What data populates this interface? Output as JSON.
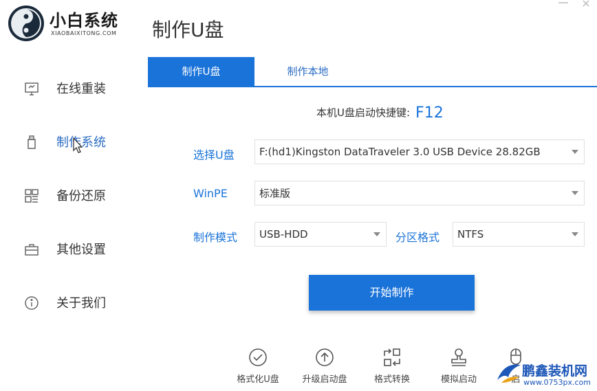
{
  "brand": {
    "name": "小白系统",
    "subtitle": "XIAOBAIXITONG.COM"
  },
  "sidebar": {
    "items": [
      {
        "label": "在线重装",
        "icon": "monitor-icon"
      },
      {
        "label": "制作系统",
        "icon": "usb-drive-icon"
      },
      {
        "label": "备份还原",
        "icon": "grid-icon"
      },
      {
        "label": "其他设置",
        "icon": "toolbox-icon"
      },
      {
        "label": "关于我们",
        "icon": "info-icon"
      }
    ]
  },
  "main": {
    "title": "制作U盘",
    "tabs": [
      {
        "label": "制作U盘",
        "active": true
      },
      {
        "label": "制作本地",
        "active": false
      }
    ],
    "hotkey_label": "本机U盘启动快捷键:",
    "hotkey_value": "F12",
    "form": {
      "usb_label": "选择U盘",
      "usb_value": "F:(hd1)Kingston DataTraveler 3.0 USB Device 28.82GB",
      "winpe_label": "WinPE",
      "winpe_value": "标准版",
      "mode_label": "制作模式",
      "mode_value": "USB-HDD",
      "partition_label": "分区格式",
      "partition_value": "NTFS"
    },
    "start_button": "开始制作",
    "tools": [
      {
        "label": "格式化U盘",
        "icon": "check-circle-icon"
      },
      {
        "label": "升级启动盘",
        "icon": "upload-circle-icon"
      },
      {
        "label": "格式转换",
        "icon": "convert-icon"
      },
      {
        "label": "模拟启动",
        "icon": "stamp-icon"
      },
      {
        "label": "启",
        "icon": "mouse-icon"
      }
    ]
  },
  "watermark": {
    "text_a": "鹏鑫",
    "text_b": "装机网",
    "url": "www.0753px.com"
  },
  "colors": {
    "accent": "#1a73d9",
    "label": "#2b6cc4"
  }
}
